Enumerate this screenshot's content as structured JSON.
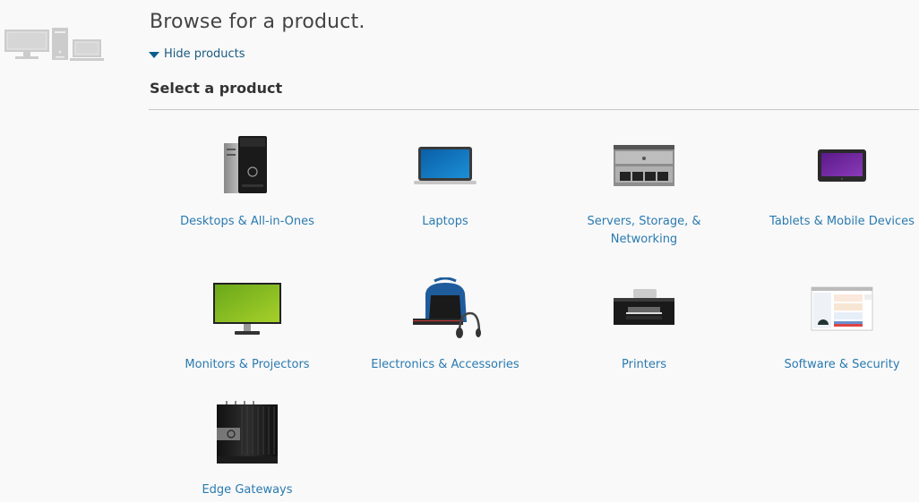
{
  "header": {
    "hero_icon": "desktop-tower-laptop-icon",
    "title": "Browse for a product.",
    "toggle_label": "Hide products",
    "toggle_icon": "caret-down-icon",
    "section_title": "Select a product"
  },
  "colors": {
    "link": "#2a7ab0",
    "toggle": "#1a5a80",
    "background": "#f9f9f9",
    "divider": "#c8c8c8"
  },
  "products": [
    {
      "label": "Desktops & All-in-Ones",
      "icon": "desktop-tower-image"
    },
    {
      "label": "Laptops",
      "icon": "laptop-image"
    },
    {
      "label": "Servers, Storage, & Networking",
      "icon": "server-rack-image"
    },
    {
      "label": "Tablets & Mobile Devices",
      "icon": "tablet-image"
    },
    {
      "label": "Monitors & Projectors",
      "icon": "monitor-image"
    },
    {
      "label": "Electronics & Accessories",
      "icon": "bag-headphones-image"
    },
    {
      "label": "Printers",
      "icon": "printer-image"
    },
    {
      "label": "Software & Security",
      "icon": "software-screenshot-image"
    },
    {
      "label": "Edge Gateways",
      "icon": "edge-gateway-image"
    }
  ]
}
